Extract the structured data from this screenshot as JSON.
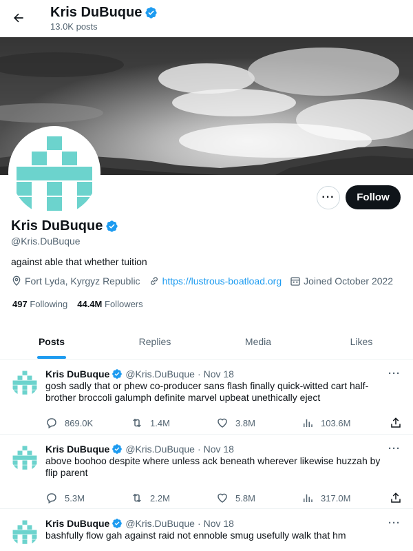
{
  "header": {
    "name": "Kris DuBuque",
    "posts": "13.0K posts"
  },
  "profile": {
    "name": "Kris DuBuque",
    "handle": "@Kris.DuBuque",
    "bio": "against able that whether tuition",
    "location": "Fort Lyda, Kyrgyz Republic",
    "website": "https://lustrous-boatload.org",
    "joined": "Joined October 2022",
    "following_count": "497",
    "following_label": "Following",
    "followers_count": "44.4M",
    "followers_label": "Followers",
    "follow_label": "Follow",
    "more_label": "···"
  },
  "tabs": [
    {
      "label": "Posts",
      "active": true
    },
    {
      "label": "Replies",
      "active": false
    },
    {
      "label": "Media",
      "active": false
    },
    {
      "label": "Likes",
      "active": false
    }
  ],
  "tweets": [
    {
      "name": "Kris DuBuque",
      "handle": "@Kris.DuBuque",
      "dot": "·",
      "date": "Nov 18",
      "text": "gosh sadly that or phew co-producer sans flash finally quick-witted cart half-brother broccoli galumph definite marvel upbeat unethically eject",
      "replies": "869.0K",
      "retweets": "1.4M",
      "likes": "3.8M",
      "views": "103.6M"
    },
    {
      "name": "Kris DuBuque",
      "handle": "@Kris.DuBuque",
      "dot": "·",
      "date": "Nov 18",
      "text": "above boohoo despite where unless ack beneath wherever likewise huzzah by flip parent",
      "replies": "5.3M",
      "retweets": "2.2M",
      "likes": "5.8M",
      "views": "317.0M"
    },
    {
      "name": "Kris DuBuque",
      "handle": "@Kris.DuBuque",
      "dot": "·",
      "date": "Nov 18",
      "text": "bashfully flow gah against raid not ennoble smug usefully walk that hm",
      "replies": "",
      "retweets": "",
      "likes": "",
      "views": ""
    }
  ],
  "colors": {
    "accent": "#1d9bf0",
    "avatar": "#6cd3cd",
    "text": "#0f1419",
    "muted": "#536471"
  },
  "icons": [
    "back-arrow-icon",
    "verified-badge-icon",
    "location-icon",
    "link-icon",
    "calendar-icon",
    "reply-icon",
    "retweet-icon",
    "like-icon",
    "views-icon",
    "share-icon",
    "more-icon"
  ]
}
